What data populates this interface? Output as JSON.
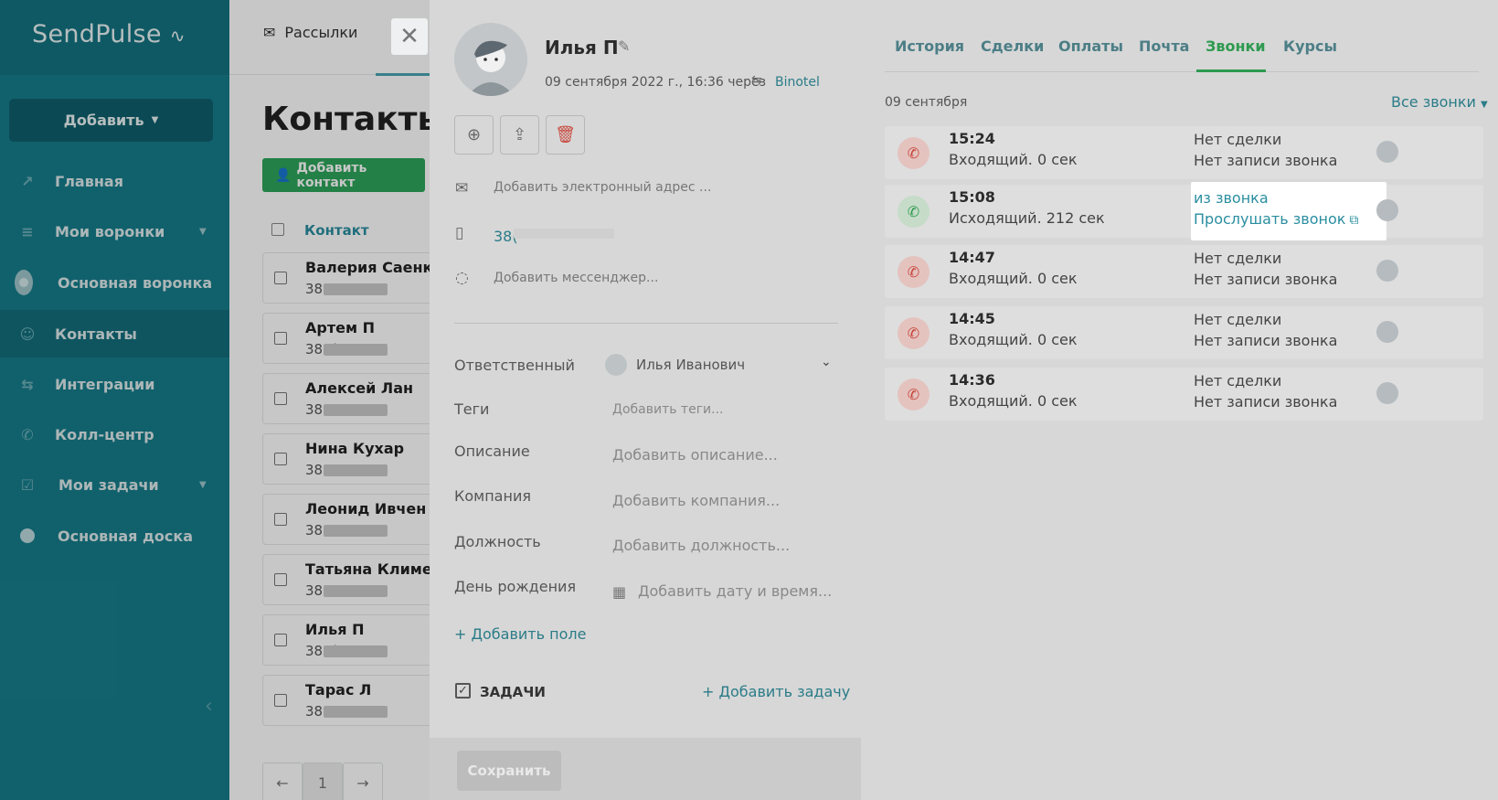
{
  "sidebar": {
    "logo": "SendPulse",
    "add_label": "Добавить",
    "items": [
      {
        "label": "Главная"
      },
      {
        "label": "Мои воронки"
      },
      {
        "label": "Основная воронка"
      },
      {
        "label": "Контакты"
      },
      {
        "label": "Интеграции"
      },
      {
        "label": "Колл-центр"
      },
      {
        "label": "Мои задачи"
      },
      {
        "label": "Основная доска"
      }
    ]
  },
  "topnav": {
    "mailings": "Рассылки"
  },
  "contacts_page": {
    "title": "Контакты",
    "add_contact": "Добавить контакт",
    "column_contact": "Контакт",
    "rows": [
      {
        "name": "Валерия Саенков",
        "phone": "3809"
      },
      {
        "name": "Артем П",
        "phone": "380("
      },
      {
        "name": "Алексей Лан",
        "phone": "3809"
      },
      {
        "name": "Нина Кухар",
        "phone": "380"
      },
      {
        "name": "Леонид Ивчен",
        "phone": "3805"
      },
      {
        "name": "Татьяна Клименк",
        "phone": "3809"
      },
      {
        "name": "Илья П",
        "phone": "380("
      },
      {
        "name": "Тарас Л",
        "phone": "380"
      }
    ],
    "pager": {
      "prev": "←",
      "page": "1",
      "next": "→"
    }
  },
  "contact": {
    "name": "Илья П",
    "meta": "09 сентября 2022 г., 16:36 через",
    "source": "Binotel",
    "email_placeholder": "Добавить электронный адрес ...",
    "phone": "38(",
    "messenger_placeholder": "Добавить мессенджер...",
    "fields": {
      "owner_label": "Ответственный",
      "owner_value": "Илья Иванович",
      "tags_label": "Теги",
      "tags_value": "Добавить теги...",
      "desc_label": "Описание",
      "desc_value": "Добавить описание...",
      "company_label": "Компания",
      "company_value": "Добавить компания...",
      "position_label": "Должность",
      "position_value": "Добавить должность...",
      "birthday_label": "День рождения",
      "birthday_value": "Добавить дату и время..."
    },
    "add_field": "+ Добавить поле",
    "tasks_label": "ЗАДАЧИ",
    "add_task": "+ Добавить задачу",
    "save": "Сохранить"
  },
  "calls": {
    "tabs": [
      "История",
      "Сделки",
      "Оплаты",
      "Почта",
      "Звонки",
      "Курсы"
    ],
    "active_tab": "Звонки",
    "date": "09 сентября",
    "all_calls": "Все звонки",
    "rows": [
      {
        "time": "15:24",
        "desc": "Входящий. 0 сек",
        "deal": "Нет сделки",
        "record": "Нет записи звонка",
        "type": "missed"
      },
      {
        "time": "15:08",
        "desc": "Исходящий. 212 сек",
        "deal": "из звонка",
        "record": "Прослушать звонок",
        "type": "out"
      },
      {
        "time": "14:47",
        "desc": "Входящий. 0 сек",
        "deal": "Нет сделки",
        "record": "Нет записи звонка",
        "type": "missed"
      },
      {
        "time": "14:45",
        "desc": "Входящий. 0 сек",
        "deal": "Нет сделки",
        "record": "Нет записи звонка",
        "type": "missed"
      },
      {
        "time": "14:36",
        "desc": "Входящий. 0 сек",
        "deal": "Нет сделки",
        "record": "Нет записи звонка",
        "type": "missed"
      }
    ]
  },
  "colors": {
    "brand": "#167d8b",
    "accent_green": "#2e9a4f",
    "link": "#2a7c88"
  }
}
